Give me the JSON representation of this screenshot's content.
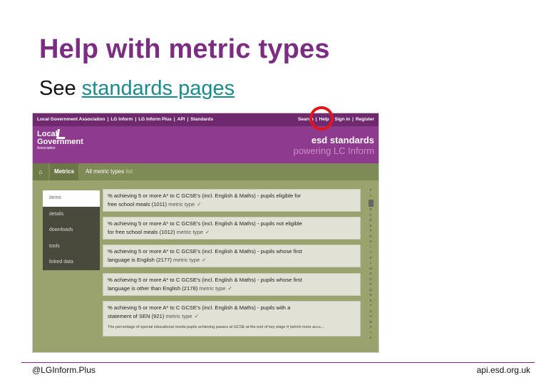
{
  "slide": {
    "title": "Help with metric types",
    "subtitle_prefix": "See ",
    "subtitle_link": "standards pages"
  },
  "website": {
    "top_nav_left": [
      "Local Government Association",
      "|",
      "LG Inform",
      "|",
      "LG Inform Plus",
      "|",
      "API",
      "|",
      "Standards"
    ],
    "top_nav_right": [
      "Search",
      "|",
      "Help",
      "|",
      "Sign in",
      "|",
      "Register"
    ],
    "logo": {
      "line1": "Local",
      "line2": "Government",
      "line3": "Association"
    },
    "brand": {
      "title": "esd standards",
      "tagline": "powering LC Inform"
    },
    "breadcrumb": {
      "home_icon": "home-icon",
      "section": "Metrics",
      "current": "All metric types",
      "current_suffix": "list"
    },
    "side_nav": [
      "items",
      "details",
      "downloads",
      "tools",
      "linked data"
    ],
    "results": [
      {
        "line1": "% achieving 5 or more A* to C GCSE's (incl. English & Maths) - pupils eligible for",
        "line2": "free school meals (1011)",
        "tag": "metric type"
      },
      {
        "line1": "% achieving 5 or more A* to C GCSE's (incl. English & Maths) - pupils not eligible",
        "line2": "for free school meals (1012)",
        "tag": "metric type"
      },
      {
        "line1": "% achieving 5 or more A* to C GCSE's (incl. English & Maths) - pupils whose first",
        "line2": "language is English (2177)",
        "tag": "metric type"
      },
      {
        "line1": "% achieving 5 or more A* to C GCSE's (incl. English & Maths) - pupils whose first",
        "line2": "language is other than English (2178)",
        "tag": "metric type"
      },
      {
        "line1": "% achieving 5 or more A* to C GCSE's (incl. English & Maths) - pupils with a",
        "line2": "statement of SEN (921)",
        "tag": "metric type",
        "desc": "The percentage of special educational needs pupils achieving passes at GCSE at the end of key stage 4 (which more accu..."
      }
    ],
    "edit_glyph": "✓",
    "alphabet": [
      "#",
      "A",
      "B",
      "C",
      "D",
      "E",
      "F",
      "G",
      "H",
      "I",
      "J",
      "K",
      "L",
      "M",
      "N",
      "O",
      "P",
      "Q",
      "R",
      "S",
      "T",
      "U",
      "V",
      "W",
      "X",
      "Y",
      "Z"
    ]
  },
  "footer": {
    "left": "@LGInform.Plus",
    "right": "api.esd.org.uk"
  },
  "colors": {
    "title": "#7b2d82",
    "link": "#1a8a8c",
    "highlight": "#e0161b"
  }
}
